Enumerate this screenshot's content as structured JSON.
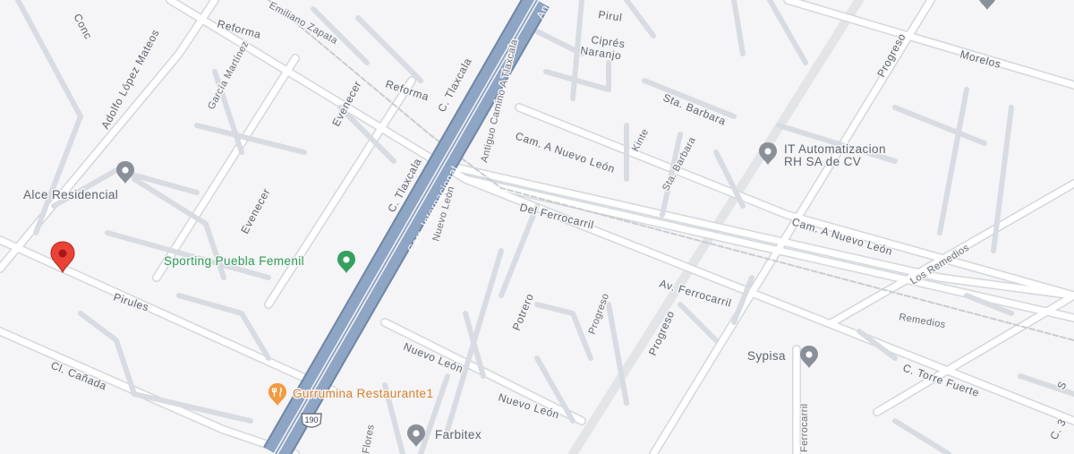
{
  "map": {
    "colors": {
      "background": "#f5f4f6",
      "road": "#ffffff",
      "road_outline": "#d3d7dd",
      "highway_fill": "#8ea5c4",
      "highway_outline": "#6f86a6",
      "rail": "#c9ccd2",
      "poi_grey": "#5f6570",
      "poi_green": "#2e9d58",
      "poi_orange": "#d9822b",
      "pin_red": "#ea4335"
    },
    "streets": {
      "conc": "Conc",
      "reforma_top": "Reforma",
      "emiliano_zapata": "Emiliano Zapata",
      "adolfo_lopez_mateos": "Adolfo López Mateos",
      "garcia_martinez": "García Martínez",
      "evenecer_top": "Evenecer",
      "reforma_mid": "Reforma",
      "c_tlaxcala_top": "C. Tlaxcala",
      "c_tlaxcala_mid": "C. Tlaxcala",
      "antiguo_camino": "Antiguo Camino A Tlaxcala",
      "evenecer_mid": "Evenecer",
      "nuevo_leon_vertical": "Nuevo León",
      "pirul": "Pirul",
      "cipres": "Ciprés",
      "naranjo": "Naranjo",
      "sta_barbara_top": "Sta. Barbara",
      "kinte": "Kinte",
      "sta_barbara_mid": "Sta. Barbara",
      "cam_nuevo_leon_top": "Cam. A Nuevo León",
      "progreso_top": "Progreso",
      "morelos": "Morelos",
      "cam_nuevo_leon_right": "Cam. A Nuevo León",
      "los_remedios": "Los Remedios",
      "remedios": "Remedios",
      "del_ferrocarril": "Del Ferrocarril",
      "av_ferrocarril": "Av. Ferrocarril",
      "potrero": "Potrero",
      "progreso_small": "Progreso",
      "progreso_mid": "Progreso",
      "pirules": "Pirules",
      "cl_canada": "Cl. Cañada",
      "nuevo_leon_low1": "Nuevo León",
      "nuevo_leon_low2": "Nuevo León",
      "flores": "Flores",
      "ferrocarril_vertical": "Ferrocarril",
      "c_torre_fuerte": "C. Torre Fuerte",
      "c_3_edge": "C. 3",
      "s_edge": "S",
      "ani_edge": "Ani"
    },
    "highway": {
      "label": "Carr. Internacional",
      "shield": "190"
    },
    "pois": [
      {
        "name": "IT Automatizacion\nRH SA de CV",
        "line1": "IT Automatizacion",
        "line2": "RH SA de CV",
        "category": "business",
        "icon": "location-pin-icon"
      },
      {
        "name": "Alce Residencial",
        "category": "residential",
        "icon": "location-pin-icon"
      },
      {
        "name": "Sporting Puebla Femenil",
        "category": "sports",
        "icon": "location-pin-icon"
      },
      {
        "name": "Gurrumina Restaurante1",
        "category": "restaurant",
        "icon": "restaurant-icon"
      },
      {
        "name": "Farbitex",
        "category": "business",
        "icon": "location-pin-icon"
      },
      {
        "name": "Sypisa",
        "category": "business",
        "icon": "location-pin-icon"
      }
    ],
    "selected_pin": {
      "icon": "red-marker-icon",
      "color": "#ea4335"
    }
  }
}
